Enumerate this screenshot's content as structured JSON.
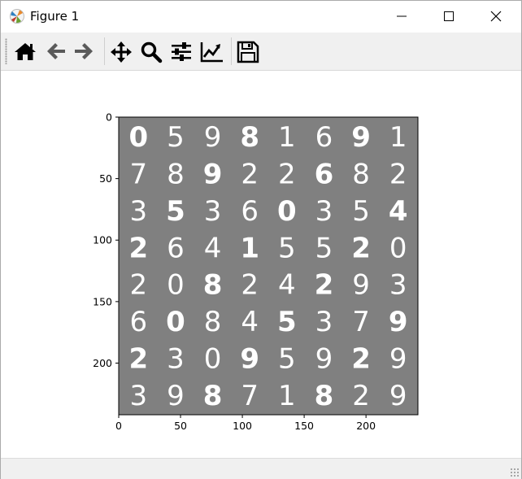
{
  "window": {
    "title": "Figure 1",
    "app_icon": "matplotlib-icon"
  },
  "title_buttons": [
    {
      "name": "minimize-button",
      "icon": "minimize-icon"
    },
    {
      "name": "maximize-button",
      "icon": "maximize-icon"
    },
    {
      "name": "close-button",
      "icon": "close-icon"
    }
  ],
  "toolbar": {
    "buttons": [
      {
        "name": "home-button",
        "icon": "home-icon",
        "tooltip": "Home"
      },
      {
        "name": "back-button",
        "icon": "back-arrow-icon",
        "tooltip": "Back"
      },
      {
        "name": "forward-button",
        "icon": "forward-arrow-icon",
        "tooltip": "Forward"
      },
      {
        "name": "pan-button",
        "icon": "move-icon",
        "tooltip": "Pan"
      },
      {
        "name": "zoom-button",
        "icon": "magnifier-icon",
        "tooltip": "Zoom"
      },
      {
        "name": "subplots-button",
        "icon": "sliders-icon",
        "tooltip": "Subplots"
      },
      {
        "name": "customize-button",
        "icon": "line-chart-icon",
        "tooltip": "Customize"
      },
      {
        "name": "save-button",
        "icon": "floppy-disk-icon",
        "tooltip": "Save"
      }
    ]
  },
  "chart_data": {
    "type": "image",
    "xlim": [
      0,
      242
    ],
    "ylim": [
      242,
      0
    ],
    "xticks": [
      "0",
      "50",
      "100",
      "150",
      "200"
    ],
    "yticks": [
      "0",
      "50",
      "100",
      "150",
      "200"
    ],
    "background_color": "#808080",
    "grid_digits": [
      [
        "0",
        "5",
        "9",
        "8",
        "1",
        "6",
        "9",
        "1"
      ],
      [
        "7",
        "8",
        "9",
        "2",
        "2",
        "6",
        "8",
        "2"
      ],
      [
        "3",
        "5",
        "3",
        "6",
        "0",
        "3",
        "5",
        "4"
      ],
      [
        "2",
        "6",
        "4",
        "1",
        "5",
        "5",
        "2",
        "0"
      ],
      [
        "2",
        "0",
        "8",
        "2",
        "4",
        "2",
        "9",
        "3"
      ],
      [
        "6",
        "0",
        "8",
        "4",
        "5",
        "3",
        "7",
        "9"
      ],
      [
        "2",
        "3",
        "0",
        "9",
        "5",
        "9",
        "2",
        "9"
      ],
      [
        "3",
        "9",
        "8",
        "7",
        "1",
        "8",
        "2",
        "9"
      ]
    ]
  }
}
